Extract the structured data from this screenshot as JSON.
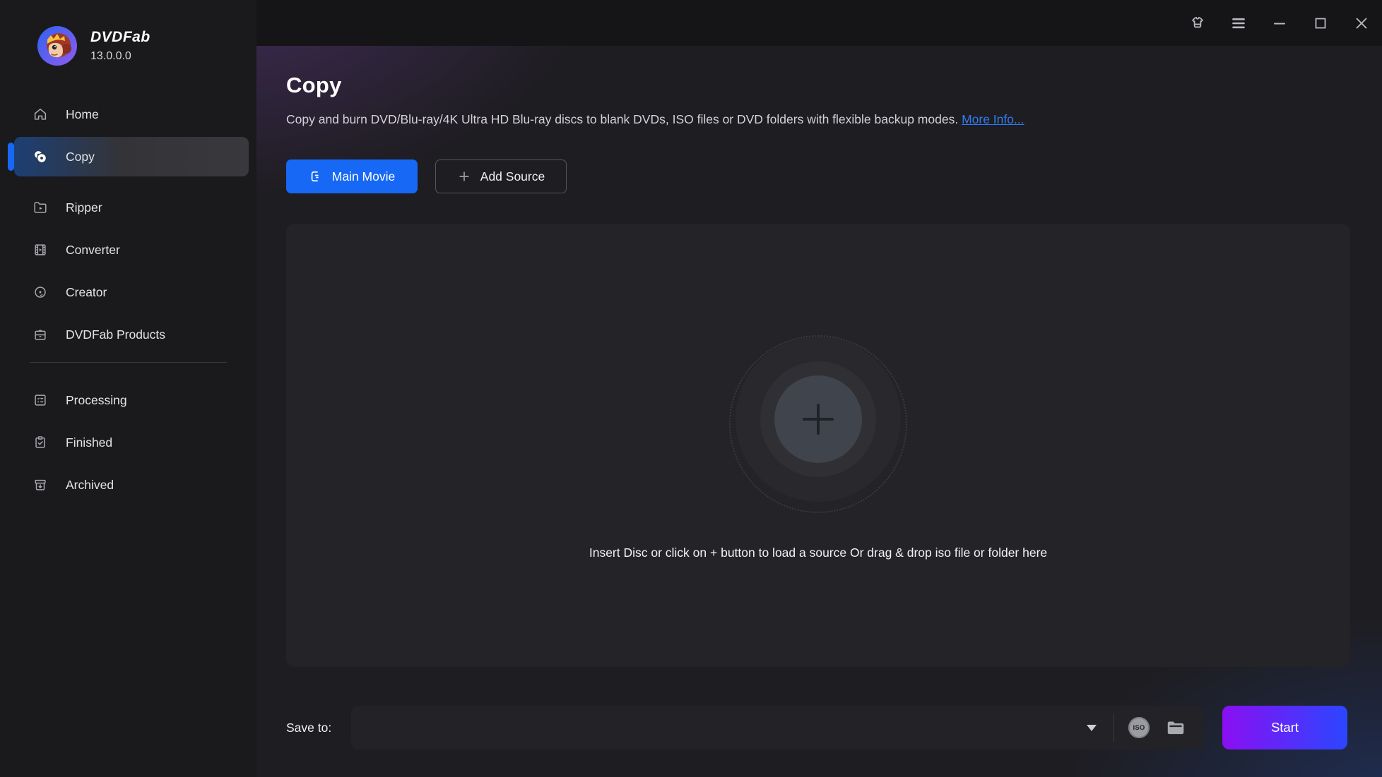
{
  "app": {
    "name": "DVDFab",
    "version": "13.0.0.0"
  },
  "titlebar": {
    "icons": [
      "theme-shirt-icon",
      "menu-icon",
      "minimize-icon",
      "maximize-icon",
      "close-icon"
    ]
  },
  "sidebar": {
    "items": [
      {
        "label": "Home",
        "icon": "home-icon"
      },
      {
        "label": "Copy",
        "icon": "copy-disc-icon",
        "active": true
      },
      {
        "label": "Ripper",
        "icon": "ripper-folder-icon"
      },
      {
        "label": "Converter",
        "icon": "converter-film-icon"
      },
      {
        "label": "Creator",
        "icon": "creator-disc-icon"
      },
      {
        "label": "DVDFab Products",
        "icon": "products-box-icon"
      }
    ],
    "library": [
      {
        "label": "Processing",
        "icon": "processing-list-icon"
      },
      {
        "label": "Finished",
        "icon": "finished-clipboard-icon"
      },
      {
        "label": "Archived",
        "icon": "archived-box-icon"
      }
    ]
  },
  "page": {
    "title": "Copy",
    "description": "Copy and burn DVD/Blu-ray/4K Ultra HD Blu-ray discs to blank DVDs, ISO files or DVD folders with flexible backup modes.",
    "more_info": "More Info..."
  },
  "toolbar": {
    "main_movie_label": "Main Movie",
    "add_source_label": "Add Source"
  },
  "dropzone": {
    "hint": "Insert Disc or click on + button to load a source Or drag & drop iso file or folder here",
    "plus_icon": "plus-icon"
  },
  "footer": {
    "save_to_label": "Save to:",
    "path_value": "",
    "iso_badge": "ISO",
    "start_label": "Start"
  },
  "colors": {
    "accent_blue": "#1668f5",
    "link_blue": "#2e7cf6",
    "start_gradient_from": "#8a0ff2",
    "start_gradient_to": "#2b46ff",
    "sidebar_bg": "#1a1a1d",
    "content_bg": "#1e1d21",
    "dropzone_bg": "#242328"
  }
}
